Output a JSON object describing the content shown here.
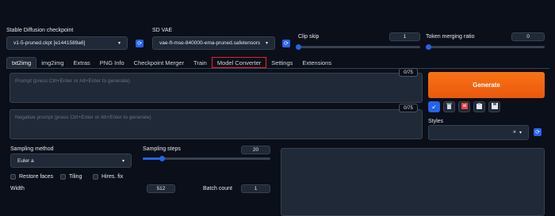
{
  "top": {
    "checkpoint": {
      "label": "Stable Diffusion checkpoint",
      "value": "v1-5-pruned.ckpt [e1441589a6]"
    },
    "vae": {
      "label": "SD VAE",
      "value": "vae-ft-mse-840000-ema-pruned.safetensors"
    },
    "clip_skip": {
      "label": "Clip skip",
      "value": "1",
      "level": 0.0
    },
    "token_merging": {
      "label": "Token merging ratio",
      "value": "0",
      "level": 0.0
    }
  },
  "tabs": [
    {
      "label": "txt2img",
      "active": true
    },
    {
      "label": "img2img"
    },
    {
      "label": "Extras"
    },
    {
      "label": "PNG Info"
    },
    {
      "label": "Checkpoint Merger"
    },
    {
      "label": "Train"
    },
    {
      "label": "Model Converter",
      "highlighted": true
    },
    {
      "label": "Settings"
    },
    {
      "label": "Extensions"
    }
  ],
  "prompt": {
    "placeholder": "Prompt (press Ctrl+Enter or Alt+Enter to generate)",
    "counter": "0/75"
  },
  "negative_prompt": {
    "placeholder": "Negative prompt (press Ctrl+Enter or Alt+Enter to generate)",
    "counter": "0/75"
  },
  "generate": {
    "label": "Generate"
  },
  "styles": {
    "label": "Styles",
    "clear_glyph": "×",
    "caret": "▾"
  },
  "sampling": {
    "method_label": "Sampling method",
    "method_value": "Euler a",
    "steps_label": "Sampling steps",
    "steps_value": "20",
    "steps_level": 0.15
  },
  "options": {
    "restore_faces": "Restore faces",
    "tiling": "Tiling",
    "hires_fix": "Hires. fix"
  },
  "size": {
    "width_label": "Width",
    "width_value": "512",
    "batch_count_label": "Batch count",
    "batch_count_value": "1"
  },
  "colors": {
    "accent": "#2563eb",
    "generate": "#f97316",
    "highlight": "#dc2626",
    "background": "#0b0f19"
  }
}
